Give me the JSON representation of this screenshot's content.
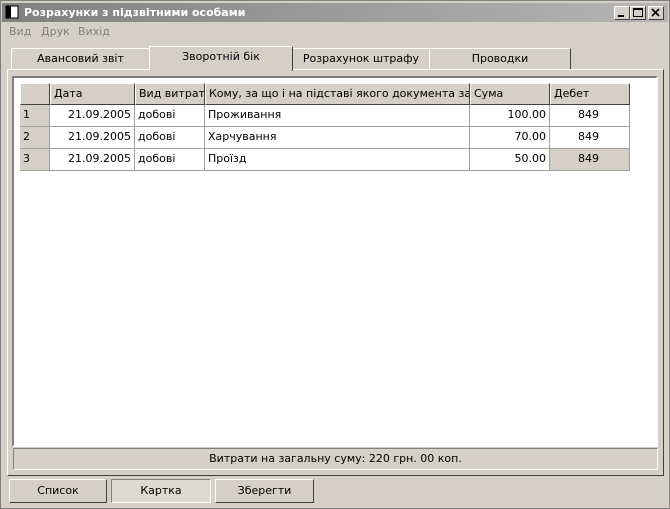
{
  "window": {
    "title": "Розрахунки з підзвітними особами"
  },
  "menu": [
    "Вид",
    "Друк",
    "Вихід"
  ],
  "tabs": [
    "Авансовий звіт",
    "Зворотній бік",
    "Розрахунок штрафу",
    "Проводки"
  ],
  "active_tab": 1,
  "table": {
    "headers": [
      "Дата",
      "Вид витрат",
      "Кому, за що і на підставі якого документа заплачено",
      "Сума",
      "Дебет"
    ],
    "rows": [
      {
        "n": "1",
        "date": "21.09.2005",
        "type": "добові",
        "desc": "Проживання",
        "sum": "100.00",
        "debit": "849"
      },
      {
        "n": "2",
        "date": "21.09.2005",
        "type": "добові",
        "desc": "Харчування",
        "sum": "70.00",
        "debit": "849"
      },
      {
        "n": "3",
        "date": "21.09.2005",
        "type": "добові",
        "desc": "Проїзд",
        "sum": "50.00",
        "debit": "849"
      }
    ]
  },
  "status": "Витрати на загальну суму: 220 грн. 00 коп.",
  "buttons": {
    "list": "Список",
    "card": "Картка",
    "save": "Зберегти"
  }
}
